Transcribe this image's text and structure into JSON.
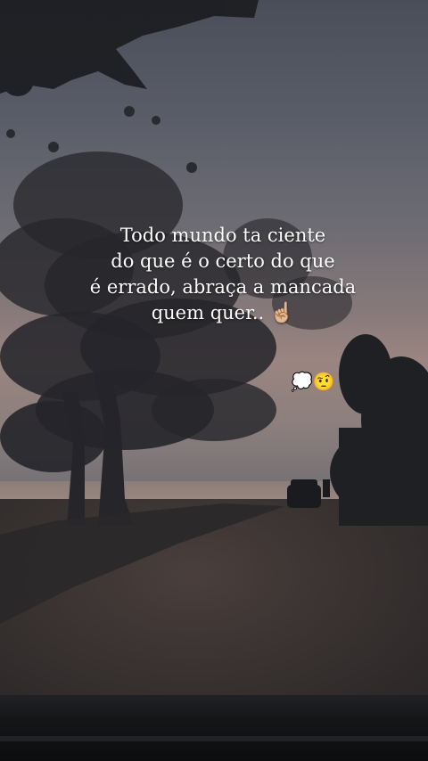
{
  "caption": {
    "line1": "Todo mundo ta ciente",
    "line2": "do que é o certo do que",
    "line3": "é errado, abraça a mancada",
    "line4": "quem quer..",
    "line4_emoji": "☝🏼"
  },
  "sticker_emojis": "💭🤨",
  "colors": {
    "sky_top": "#4a4e59",
    "horizon": "#9a8580",
    "ground": "#3a3332",
    "text": "#ffffff"
  }
}
